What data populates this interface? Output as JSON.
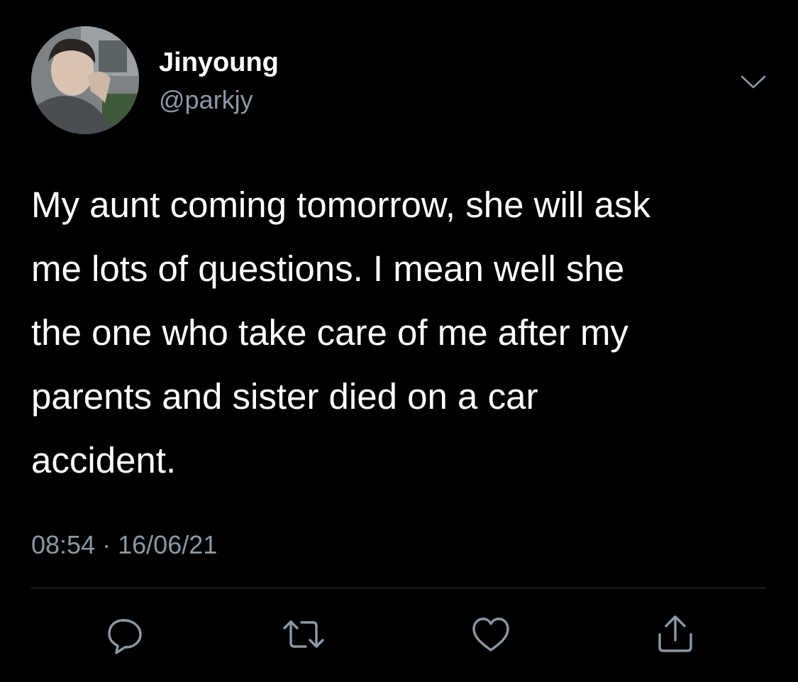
{
  "tweet": {
    "author": {
      "display_name": "Jinyoung",
      "handle": "@parkjy",
      "avatar_icon": "profile-photo"
    },
    "text": "My aunt coming tomorrow, she will ask\nme lots of questions. I mean well she\nthe one who take care of me after my\nparents and sister died on a car\naccident.",
    "time": "08:54",
    "separator": "·",
    "date": "16/06/21"
  },
  "actions": [
    {
      "name": "reply",
      "icon": "reply-icon"
    },
    {
      "name": "retweet",
      "icon": "retweet-icon"
    },
    {
      "name": "like",
      "icon": "heart-icon"
    },
    {
      "name": "share",
      "icon": "share-icon"
    }
  ],
  "colors": {
    "background": "#000000",
    "primary_text": "#ffffff",
    "secondary_text": "#8b98a5",
    "divider": "#2f3336"
  }
}
